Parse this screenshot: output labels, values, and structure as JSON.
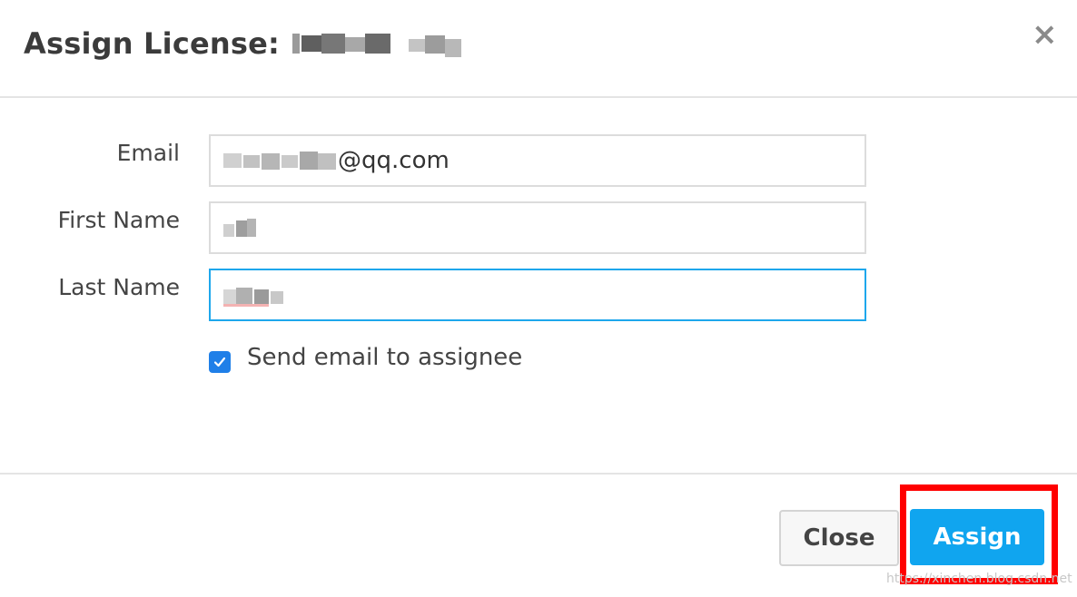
{
  "dialog": {
    "title": "Assign License:",
    "close_symbol": "×",
    "close_icon": "close-icon"
  },
  "form": {
    "email": {
      "label": "Email",
      "value_visible": "@qq.com"
    },
    "first_name": {
      "label": "First Name",
      "value_visible": ""
    },
    "last_name": {
      "label": "Last Name",
      "value_visible": ""
    },
    "send_email": {
      "label": "Send email to assignee",
      "checked": true
    }
  },
  "footer": {
    "close_label": "Close",
    "assign_label": "Assign"
  },
  "watermark": "https://xinchen.blog.csdn.net",
  "colors": {
    "accent": "#10a5ef",
    "focus_border": "#1ea7ec",
    "checkbox": "#1f7fe8",
    "highlight": "#ff0000"
  }
}
